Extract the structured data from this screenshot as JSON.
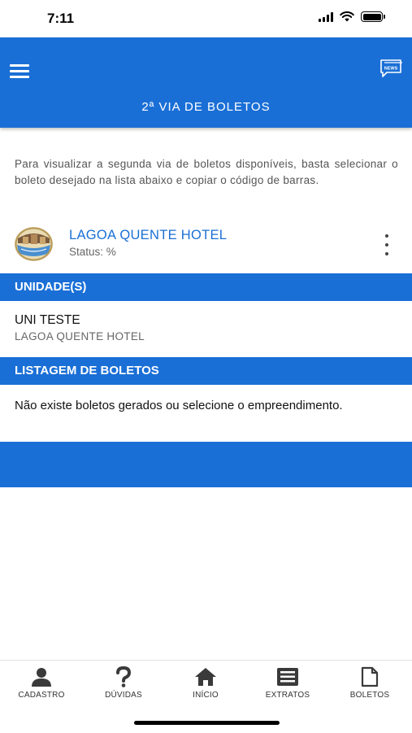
{
  "status_bar": {
    "time": "7:11"
  },
  "header": {
    "title": "2ª VIA DE BOLETOS",
    "news_badge": "NEWS"
  },
  "intro": {
    "text": "Para visualizar a segunda via de boletos disponíveis, basta selecionar o boleto desejado na lista abaixo e copiar o código de barras."
  },
  "property": {
    "name": "LAGOA QUENTE HOTEL",
    "status": "Status: %"
  },
  "units_section": {
    "title": "UNIDADE(S)",
    "unit_name": "UNI TESTE",
    "unit_property": "LAGOA QUENTE HOTEL"
  },
  "boletos_section": {
    "title": "LISTAGEM DE BOLETOS",
    "empty_message": "Não existe boletos gerados ou selecione o empreendimento."
  },
  "tabbar": {
    "items": [
      {
        "label": "CADASTRO",
        "icon": "person-icon"
      },
      {
        "label": "DÚVIDAS",
        "icon": "question-icon"
      },
      {
        "label": "INÍCIO",
        "icon": "home-icon"
      },
      {
        "label": "EXTRATOS",
        "icon": "list-icon"
      },
      {
        "label": "BOLETOS",
        "icon": "document-icon"
      }
    ]
  },
  "colors": {
    "primary": "#1a6fd6",
    "icon_dark": "#3a3a3a"
  }
}
